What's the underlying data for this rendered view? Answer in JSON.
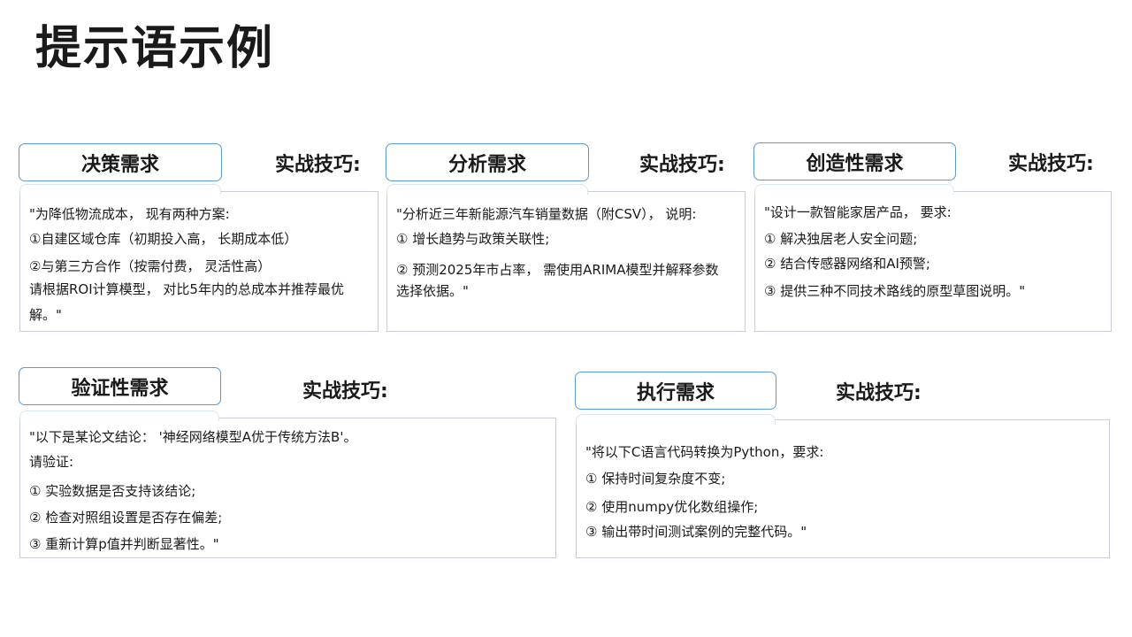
{
  "page": {
    "title": "提示语示例"
  },
  "tip_label": "实战技巧:",
  "cards": {
    "decision": {
      "title": "决策需求",
      "lines": [
        "\"为降低物流成本， 现有两种方案:",
        "①自建区域仓库（初期投入高， 长期成本低）",
        "②与第三方合作（按需付费， 灵活性高）",
        "请根据ROI计算模型， 对比5年内的总成本并推荐最优",
        "解。\""
      ]
    },
    "analysis": {
      "title": "分析需求",
      "lines": [
        "\"分析近三年新能源汽车销量数据（附CSV）， 说明:",
        "① 增长趋势与政策关联性;",
        "② 预测2025年市占率， 需使用ARIMA模型并解释参数",
        "选择依据。\""
      ]
    },
    "creative": {
      "title": "创造性需求",
      "lines": [
        "\"设计一款智能家居产品， 要求:",
        "① 解决独居老人安全问题;",
        "② 结合传感器网络和AI预警;",
        "③ 提供三种不同技术路线的原型草图说明。\""
      ]
    },
    "verification": {
      "title": "验证性需求",
      "lines": [
        "\"以下是某论文结论： '神经网络模型A优于传统方法B'。",
        "请验证:",
        "① 实验数据是否支持该结论;",
        "② 检查对照组设置是否存在偏差;",
        "③ 重新计算p值并判断显著性。\""
      ]
    },
    "execution": {
      "title": "执行需求",
      "lines": [
        "\"将以下C语言代码转换为Python，要求:",
        "① 保持时间复杂度不变;",
        "② 使用numpy优化数组操作;",
        "③ 输出带时间测试案例的完整代码。\""
      ]
    }
  }
}
